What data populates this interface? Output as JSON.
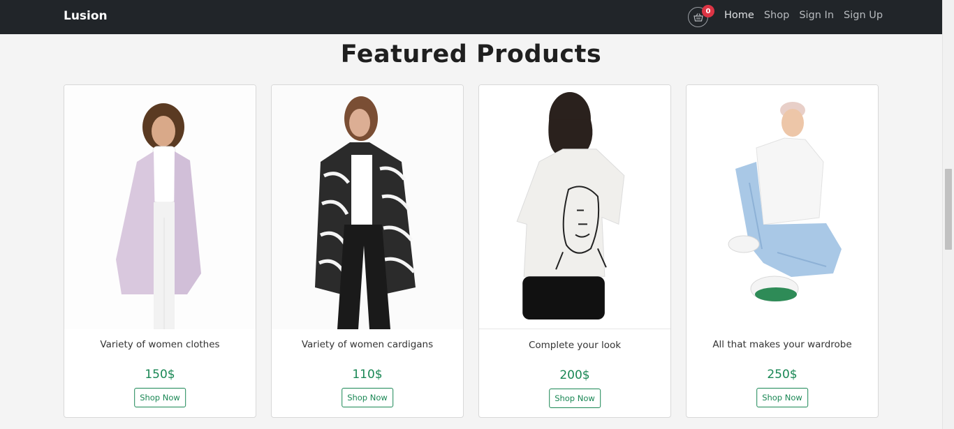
{
  "navbar": {
    "brand": "Lusion",
    "cart_count": "0",
    "links": [
      {
        "label": "Home"
      },
      {
        "label": "Shop"
      },
      {
        "label": "Sign In"
      },
      {
        "label": "Sign Up"
      }
    ]
  },
  "section": {
    "title": "Featured Products"
  },
  "products": [
    {
      "description": "Variety of women clothes",
      "price": "150$",
      "button": "Shop Now"
    },
    {
      "description": "Variety of women cardigans",
      "price": "110$",
      "button": "Shop Now"
    },
    {
      "description": "Complete your look",
      "price": "200$",
      "button": "Shop Now"
    },
    {
      "description": "All that makes your wardrobe",
      "price": "250$",
      "button": "Shop Now"
    }
  ],
  "colors": {
    "navbar_bg": "#212529",
    "accent_green": "#198754",
    "badge_red": "#dc3545",
    "page_bg": "#f4f4f4"
  }
}
